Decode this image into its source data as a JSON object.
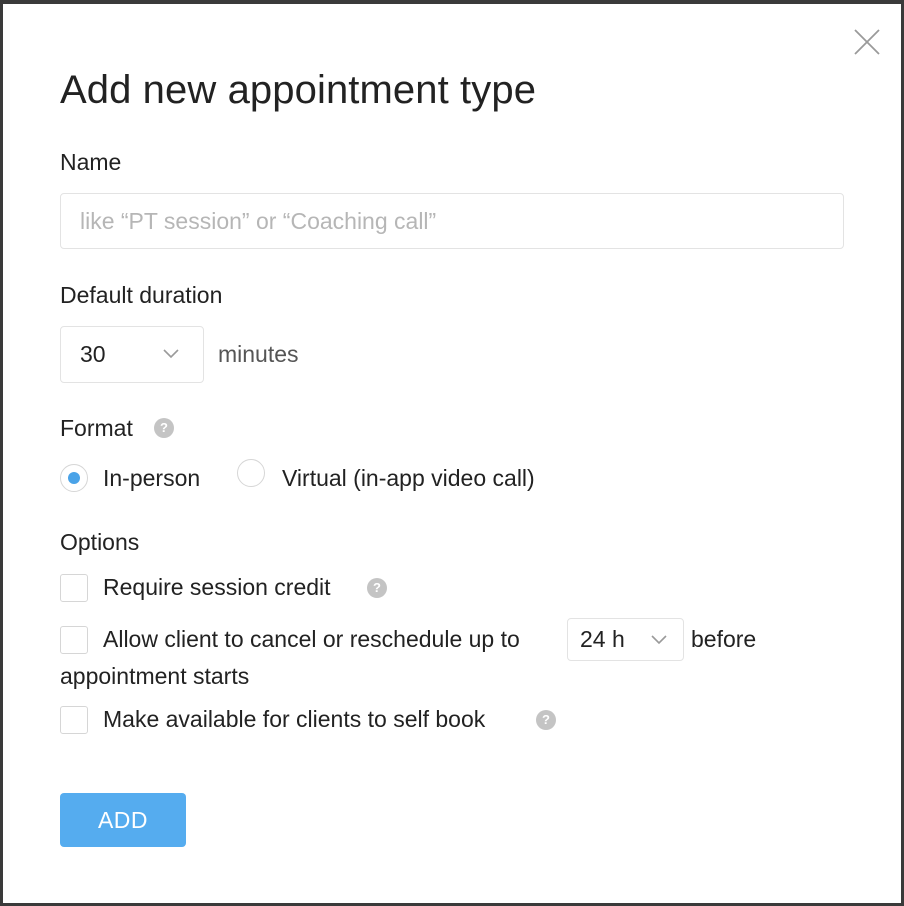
{
  "dialog": {
    "title": "Add new appointment type",
    "close_icon": "close-icon"
  },
  "name_field": {
    "label": "Name",
    "value": "",
    "placeholder": "like “PT session” or “Coaching call”"
  },
  "duration": {
    "label": "Default duration",
    "selected": "30",
    "unit": "minutes"
  },
  "format": {
    "label": "Format",
    "help_icon": "question-icon",
    "options": [
      {
        "label": "In-person",
        "checked": true
      },
      {
        "label": "Virtual (in-app video call)",
        "checked": false
      }
    ]
  },
  "options": {
    "label": "Options",
    "items": [
      {
        "label": "Require session credit",
        "checked": false,
        "help": "?"
      },
      {
        "label_before": "Allow client to cancel or reschedule up to",
        "select_value": "24 h",
        "label_after": "before",
        "label_wrap": "appointment starts",
        "checked": false
      },
      {
        "label": "Make available for clients to self book",
        "checked": false,
        "help": "?"
      }
    ]
  },
  "format_help": "?",
  "submit": {
    "label": "ADD"
  },
  "colors": {
    "accent": "#55acef",
    "radio_dot": "#4aa3e8",
    "help_bg": "#c4c4c4"
  }
}
